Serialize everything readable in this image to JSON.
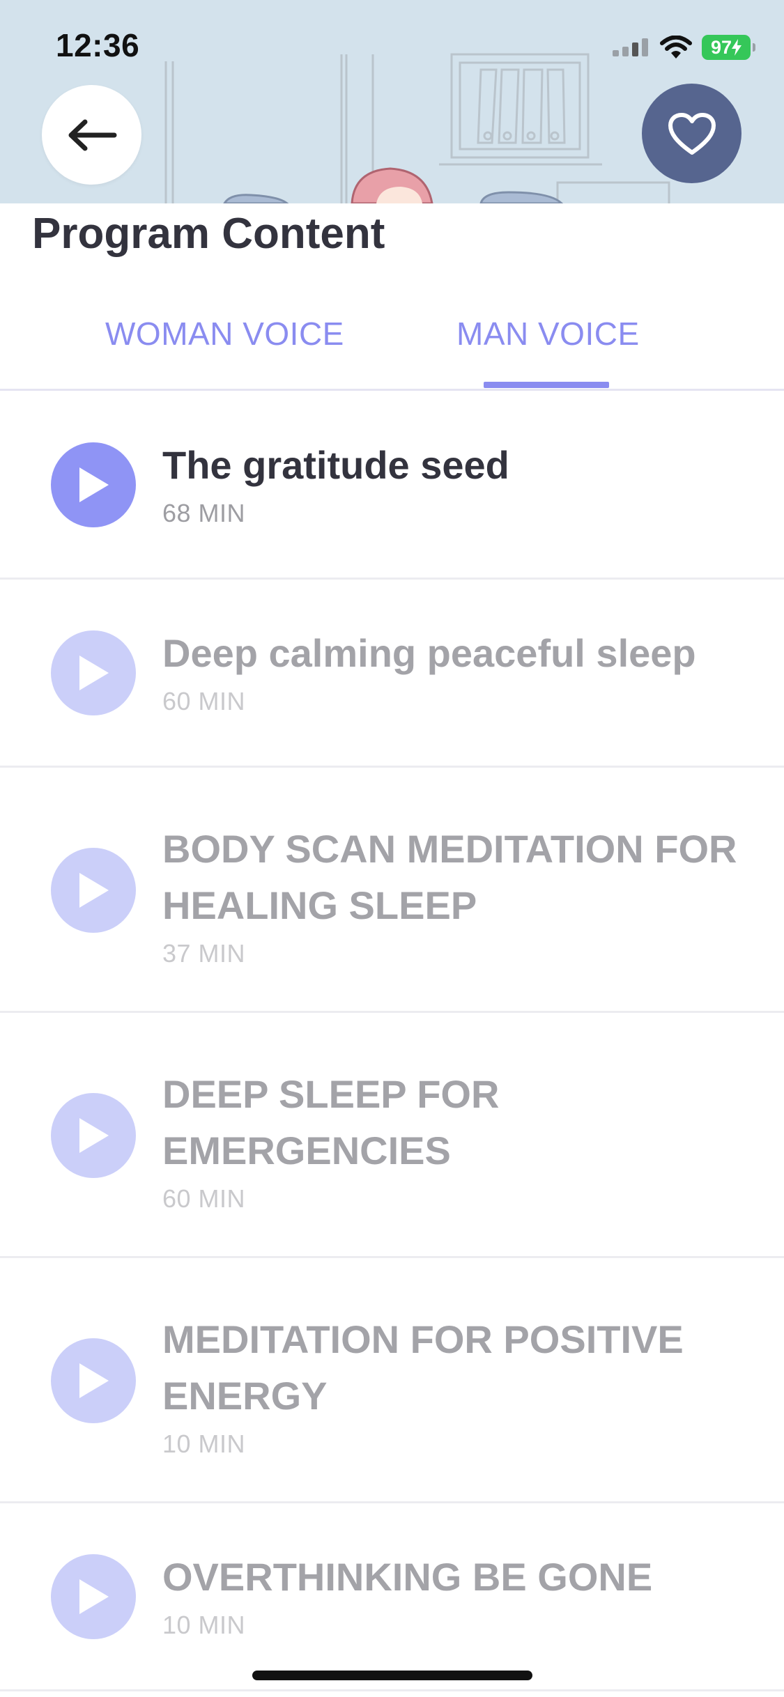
{
  "status_bar": {
    "time": "12:36",
    "battery": "97"
  },
  "header": {
    "back_icon": "arrow-left-icon",
    "favorite_icon": "heart-outline-icon"
  },
  "section": {
    "title": "Program Content"
  },
  "tabs": [
    {
      "label": "WOMAN VOICE",
      "active": false
    },
    {
      "label": "MAN VOICE",
      "active": true
    }
  ],
  "tracks": [
    {
      "title": "The gratitude seed",
      "duration": "68 MIN",
      "locked": false
    },
    {
      "title": "Deep calming peaceful sleep",
      "duration": "60 MIN",
      "locked": true
    },
    {
      "title": "BODY SCAN MEDITATION FOR HEALING SLEEP",
      "duration": "37 MIN",
      "locked": true
    },
    {
      "title": "DEEP SLEEP FOR EMERGENCIES",
      "duration": "60 MIN",
      "locked": true
    },
    {
      "title": "MEDITATION FOR POSITIVE ENERGY",
      "duration": "10 MIN",
      "locked": true
    },
    {
      "title": "OVERTHINKING BE GONE",
      "duration": "10 MIN",
      "locked": true
    }
  ],
  "colors": {
    "accent": "#8a8cf0",
    "play_active": "#8f94f5",
    "play_locked": "#cbcff9",
    "favorite_button": "#56658f",
    "header_background": "#d3e2ec",
    "battery": "#35c759"
  }
}
